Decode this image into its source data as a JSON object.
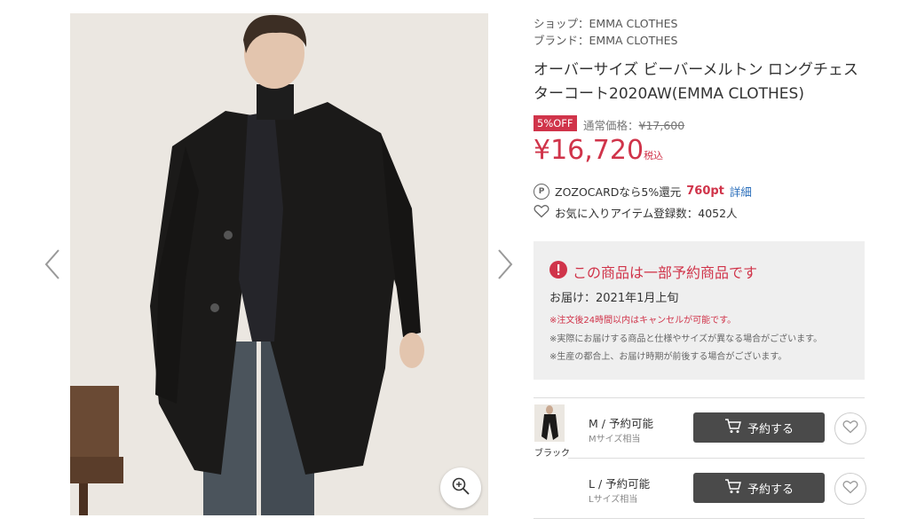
{
  "shop": {
    "label": "ショップ：",
    "name": "EMMA CLOTHES"
  },
  "brand": {
    "label": "ブランド：",
    "name": "EMMA CLOTHES"
  },
  "product": {
    "title": "オーバーサイズ ビーバーメルトン ロングチェスターコート2020AW(EMMA CLOTHES)",
    "discount_badge": "5%OFF",
    "regular_price_label": "通常価格：",
    "regular_price": "¥17,600",
    "price": "¥16,720",
    "tax_label": "税込"
  },
  "points": {
    "icon_letter": "P",
    "text": "ZOZOCARDなら5%還元",
    "amount": "760pt",
    "link": "詳細"
  },
  "favorites": {
    "text": "お気に入りアイテム登録数：4052人"
  },
  "notice": {
    "heading": "この商品は一部予約商品です",
    "delivery": "お届け：2021年1月上旬",
    "note1": "※注文後24時間以内はキャンセルが可能です。",
    "note2": "※実際にお届けする商品と仕様やサイズが異なる場合がございます。",
    "note3": "※生産の都合上、お届け時期が前後する場合がございます。"
  },
  "color": {
    "name": "ブラック"
  },
  "sizes": [
    {
      "label": "M / 予約可能",
      "sub": "Mサイズ相当",
      "button": "予約する"
    },
    {
      "label": "L / 予約可能",
      "sub": "Lサイズ相当",
      "button": "予約する"
    }
  ],
  "colors": {
    "accent": "#d0344a",
    "button": "#4a4a4a",
    "panel": "#efefef"
  }
}
